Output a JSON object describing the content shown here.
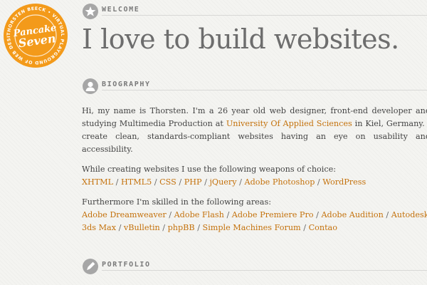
{
  "badge": {
    "brand_line1": "Pancake",
    "brand_line2": "Seven",
    "ring_text": "THORSTEN BEECK • VIRTUAL PLAYGROUND OF WEB DESIGNER AND DEVELOPER •",
    "color": "#f39a1a"
  },
  "welcome": {
    "label": "WELCOME",
    "icon": "star-icon",
    "headline": "I love to build websites."
  },
  "biography": {
    "label": "BIOGRAPHY",
    "icon": "person-icon",
    "intro_pre": "Hi, my name is Thorsten. I'm a 26 year old web designer, front-end developer and studying Multimedia Production at ",
    "intro_link": "University Of Applied Sciences",
    "intro_post": " in Kiel, Germany. I create clean, standards-compliant websites having an eye on usability and accessibility.",
    "weapons_intro": "While creating websites I use the following weapons of choice:",
    "weapons": [
      "XHTML",
      "HTML5",
      "CSS",
      "PHP",
      "jQuery",
      "Adobe Photoshop",
      "WordPress"
    ],
    "skills_intro": "Furthermore I'm skilled in the following areas:",
    "skills": [
      "Adobe Dreamweaver",
      "Adobe Flash",
      "Adobe Premiere Pro",
      "Adobe Audition",
      "Autodesk 3ds Max",
      "vBulletin",
      "phpBB",
      "Simple Machines Forum",
      "Contao"
    ],
    "separator": "/"
  },
  "portfolio": {
    "label": "PORTFOLIO",
    "icon": "pencil-icon"
  },
  "colors": {
    "accent": "#c4720d",
    "badge": "#f39a1a",
    "text": "#444444",
    "headline": "#6d6d6d"
  }
}
